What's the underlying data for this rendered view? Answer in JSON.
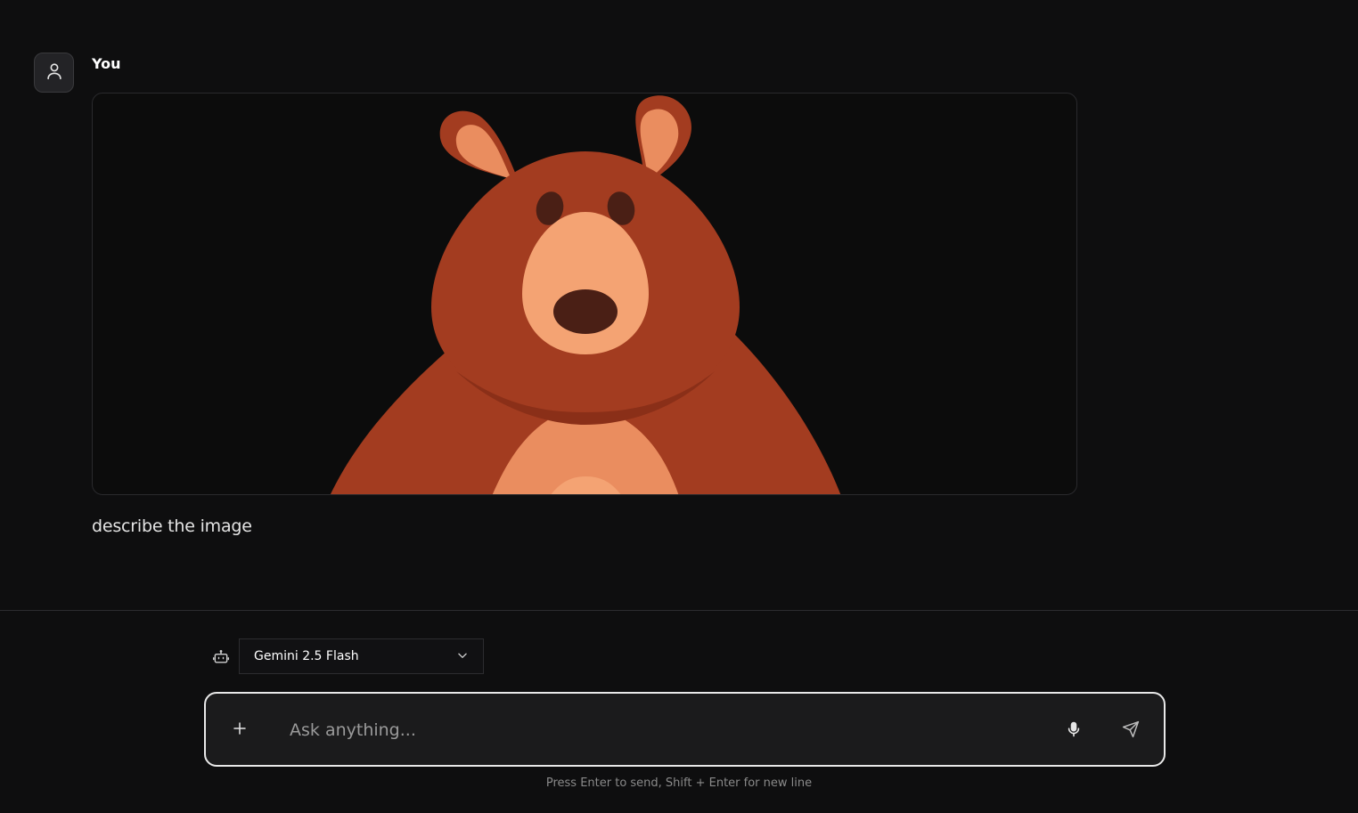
{
  "message": {
    "sender": "You",
    "text": "describe the image",
    "attachment": {
      "kind": "image",
      "subject": "cartoon brown bear",
      "colors": {
        "background": "#0c0c0c",
        "body": "#a33c20",
        "muzzle": "#f4a373",
        "belly": "#ea8d5f",
        "nose": "#4a1f15",
        "eyes": "#4a1f15",
        "inner_ear": "#ea8d5f"
      }
    }
  },
  "composer": {
    "model_label": "Gemini 2.5 Flash",
    "input_placeholder": "Ask anything...",
    "hint": "Press Enter to send, Shift + Enter for new line"
  },
  "icons": {
    "avatar": "user-icon",
    "model": "bot-icon",
    "dropdown": "chevron-down-icon",
    "attach": "plus-icon",
    "voice": "microphone-icon",
    "send": "send-icon"
  },
  "theme": {
    "background": "#0e0e0f",
    "input_border": "#e9e9e9",
    "input_background": "#1b1b1c"
  }
}
